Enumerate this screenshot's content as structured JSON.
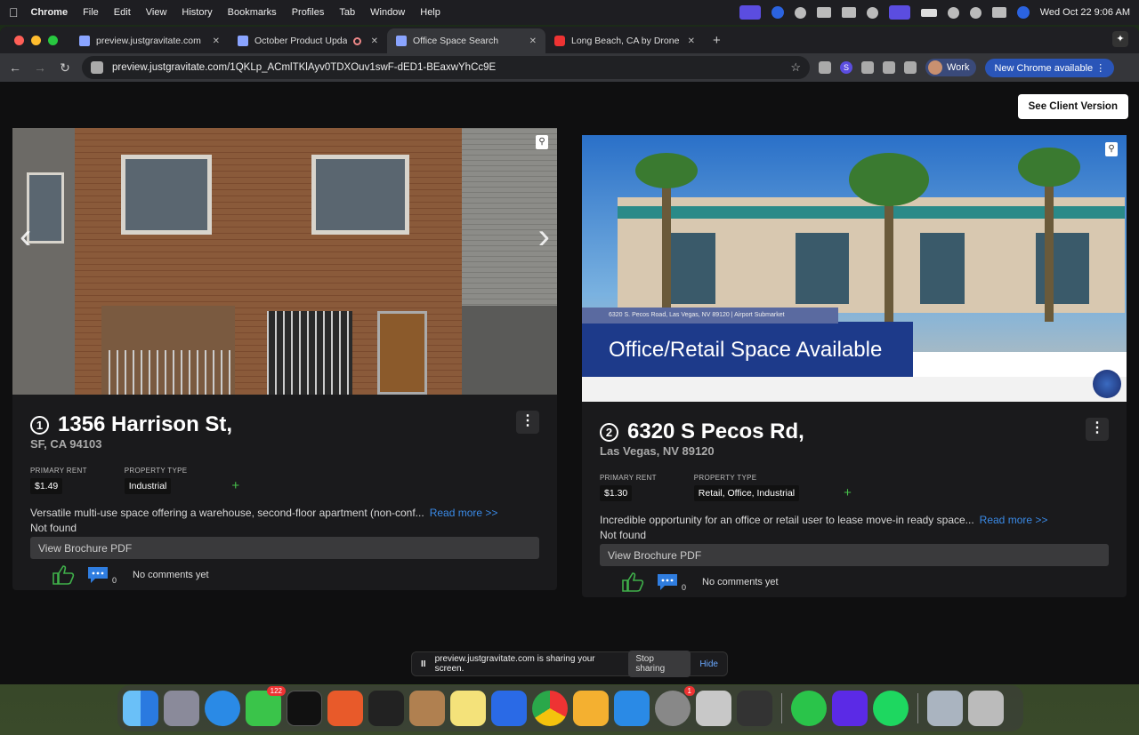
{
  "menubar": {
    "app": "Chrome",
    "items": [
      "File",
      "Edit",
      "View",
      "History",
      "Bookmarks",
      "Profiles",
      "Tab",
      "Window",
      "Help"
    ],
    "clock": "Wed Oct 22  9:06 AM"
  },
  "tabs": [
    {
      "title": "preview.justgravitate.com",
      "icon": "gravitate-icon"
    },
    {
      "title": "October Product Update",
      "icon": "gravitate-icon"
    },
    {
      "title": "Office Space Search",
      "icon": "gravitate-icon",
      "active": true
    },
    {
      "title": "Long Beach, CA by Drone - Y",
      "icon": "youtube-icon"
    }
  ],
  "toolbar": {
    "url": "preview.justgravitate.com/1QKLp_ACmlTKlAyv0TDXOuv1swF-dED1-BEaxwYhCc9E",
    "profile": "Work",
    "update": "New Chrome available"
  },
  "page": {
    "client_button": "See Client Version",
    "listings": [
      {
        "number": "1",
        "street": "1356 Harrison St,",
        "city": "SF, CA 94103",
        "rent_label": "PRIMARY RENT",
        "rent": "$1.49",
        "type_label": "PROPERTY TYPE",
        "type": "Industrial",
        "description": "Versatile multi-use space offering a warehouse, second-floor apartment (non-conf...",
        "read_more": "Read more >>",
        "status": "Not found",
        "brochure": "View Brochure PDF",
        "comment_count": "0",
        "comments": "No comments yet"
      },
      {
        "number": "2",
        "street": "6320 S Pecos Rd,",
        "city": "Las Vegas, NV 89120",
        "rent_label": "PRIMARY RENT",
        "rent": "$1.30",
        "type_label": "PROPERTY TYPE",
        "type": "Retail, Office, Industrial",
        "description": "Incredible opportunity for an office or retail user to lease move-in ready space...",
        "read_more": "Read more >>",
        "status": "Not found",
        "brochure": "View Brochure PDF",
        "comment_count": "0",
        "comments": "No comments yet",
        "image_address": "6320 S. Pecos Road, Las Vegas, NV 89120 | Airport Submarket",
        "image_headline": "Office/Retail Space Available"
      }
    ]
  },
  "share_bar": {
    "text": "preview.justgravitate.com is sharing your screen.",
    "stop": "Stop sharing",
    "hide": "Hide"
  },
  "dock": {
    "messages_badge": "122",
    "settings_badge": "1"
  },
  "colors": {
    "accent_link": "#3a8ae6",
    "add_green": "#46c04a",
    "chrome_update": "#2a55b8"
  }
}
